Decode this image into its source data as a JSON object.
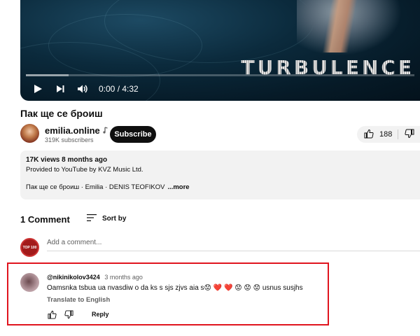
{
  "player": {
    "overlay_text": "TURBULENCE",
    "time": "0:00 / 4:32",
    "progress_fraction": 0.0,
    "controls": [
      "play-icon",
      "next-icon",
      "volume-icon"
    ]
  },
  "video": {
    "title": "Пак ще се броиш"
  },
  "channel": {
    "name": "emilia.online",
    "verified_icon": "music-note-icon",
    "subscribers": "319K subscribers",
    "subscribe_label": "Subscribe"
  },
  "actions": {
    "likes": "188"
  },
  "description": {
    "meta": "17K views  8 months ago",
    "provided_by": "Provided to YouTube by KVZ Music Ltd.",
    "tags_line": "Пак ще се броиш · Emilia · DENIS TEOFIKOV",
    "more_label": "...more"
  },
  "comments": {
    "count_label": "1 Comment",
    "sort_label": "Sort by",
    "my_avatar_text": "TOP 100",
    "add_placeholder": "Add a comment...",
    "items": [
      {
        "author": "@nikinikolov3424",
        "when": "3 months ago",
        "text": "Oamsnka tsbua ua nvasdiw o da ks s sjs zjvs aia s😟 ❤️ ❤️ 😟 😟 😟 usnus susjhs",
        "translate_label": "Translate to English",
        "reply_label": "Reply"
      }
    ]
  },
  "colors": {
    "highlight_border": "#e0141e",
    "subscribe_bg": "#0f0f0f",
    "progress": "#ff0000"
  }
}
